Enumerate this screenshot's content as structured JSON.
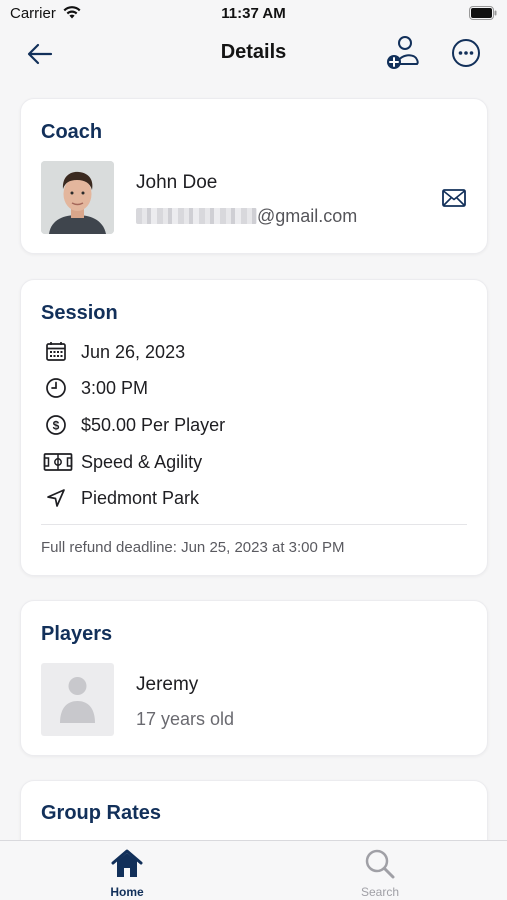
{
  "status_bar": {
    "carrier": "Carrier",
    "time": "11:37 AM"
  },
  "nav": {
    "title": "Details"
  },
  "coach": {
    "section_title": "Coach",
    "name": "John Doe",
    "email_visible_part": "@gmail.com"
  },
  "session": {
    "section_title": "Session",
    "date": "Jun 26, 2023",
    "time": "3:00 PM",
    "price": "$50.00 Per Player",
    "type": "Speed & Agility",
    "location": "Piedmont Park",
    "refund_deadline": "Full refund deadline: Jun 25, 2023 at 3:00 PM"
  },
  "players": {
    "section_title": "Players",
    "items": [
      {
        "name": "Jeremy",
        "age": "17 years old"
      }
    ]
  },
  "group_rates": {
    "section_title": "Group Rates"
  },
  "tabs": [
    {
      "label": "Home",
      "active": true
    },
    {
      "label": "Search",
      "active": false
    }
  ],
  "colors": {
    "accent": "#12305a",
    "inactive": "#a0a0a6"
  }
}
